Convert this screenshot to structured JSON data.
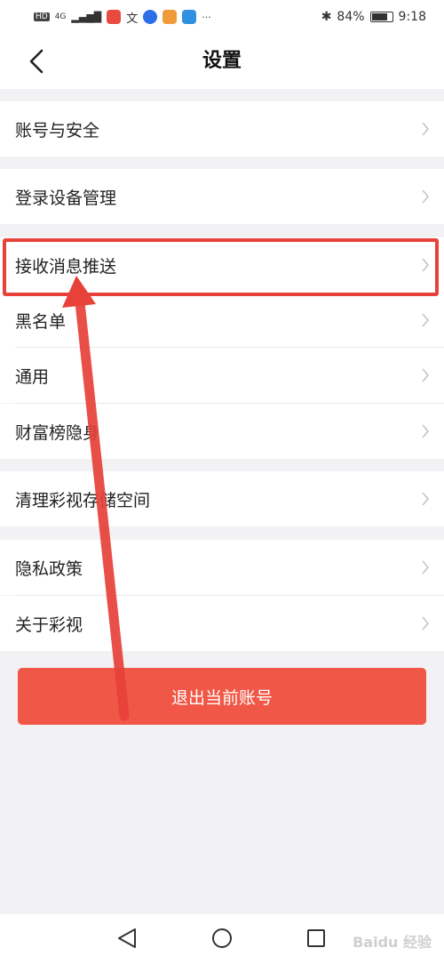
{
  "status_bar": {
    "left_icons": [
      "HD",
      "4G"
    ],
    "battery": "84%",
    "battery_level": 0.84,
    "time": "9:18"
  },
  "header": {
    "title": "设置"
  },
  "menu": {
    "account_security": "账号与安全",
    "device_management": "登录设备管理",
    "message_push": "接收消息推送",
    "blacklist": "黑名单",
    "general": "通用",
    "wealth_hidden": "财富榜隐身",
    "clear_storage": "清理彩视存储空间",
    "privacy_policy": "隐私政策",
    "about": "关于彩视"
  },
  "logout_label": "退出当前账号",
  "watermark": "Baidu 经验",
  "colors": {
    "accent": "#f05746",
    "highlight": "#e8413a"
  }
}
